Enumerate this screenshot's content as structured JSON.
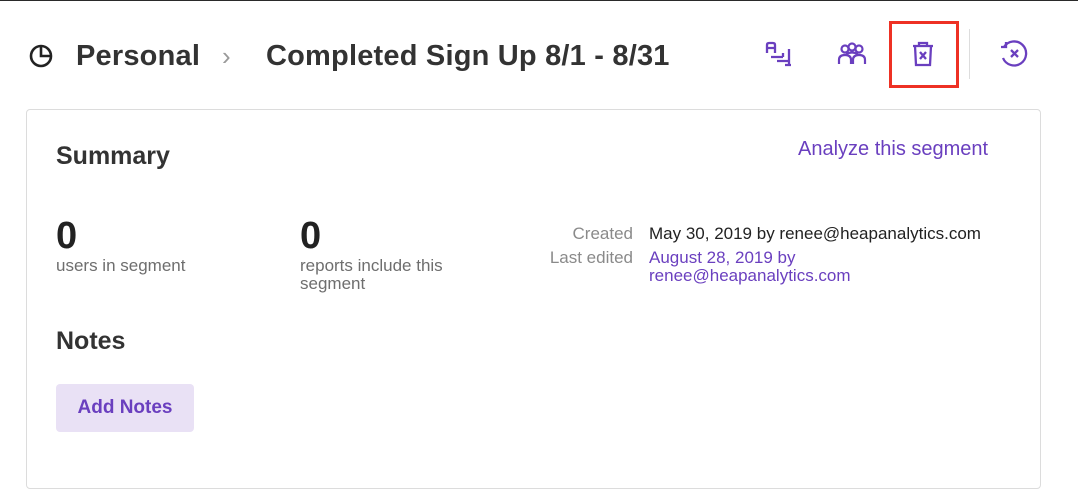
{
  "header": {
    "icon": "segment-pie-icon",
    "breadcrumb_root": "Personal",
    "breadcrumb_separator": "›",
    "title": "Completed Sign Up 8/1 - 8/31",
    "actions": [
      {
        "icon": "rename-icon"
      },
      {
        "icon": "people-icon"
      },
      {
        "icon": "trash-icon",
        "highlighted": true
      },
      {
        "icon": "close-circle-icon"
      }
    ]
  },
  "summary": {
    "title": "Summary",
    "analyze_link": "Analyze this segment",
    "users_count": "0",
    "users_label": "users in segment",
    "reports_count": "0",
    "reports_label": "reports include this segment",
    "created_key": "Created",
    "created_value": "May 30, 2019 by renee@heapanalytics.com",
    "edited_key": "Last edited",
    "edited_value": "August 28, 2019 by renee@heapanalytics.com"
  },
  "notes": {
    "title": "Notes",
    "add_button": "Add Notes"
  },
  "colors": {
    "accent": "#6a3fbf",
    "highlight": "#ee3124",
    "button_bg": "#e9e1f5"
  }
}
